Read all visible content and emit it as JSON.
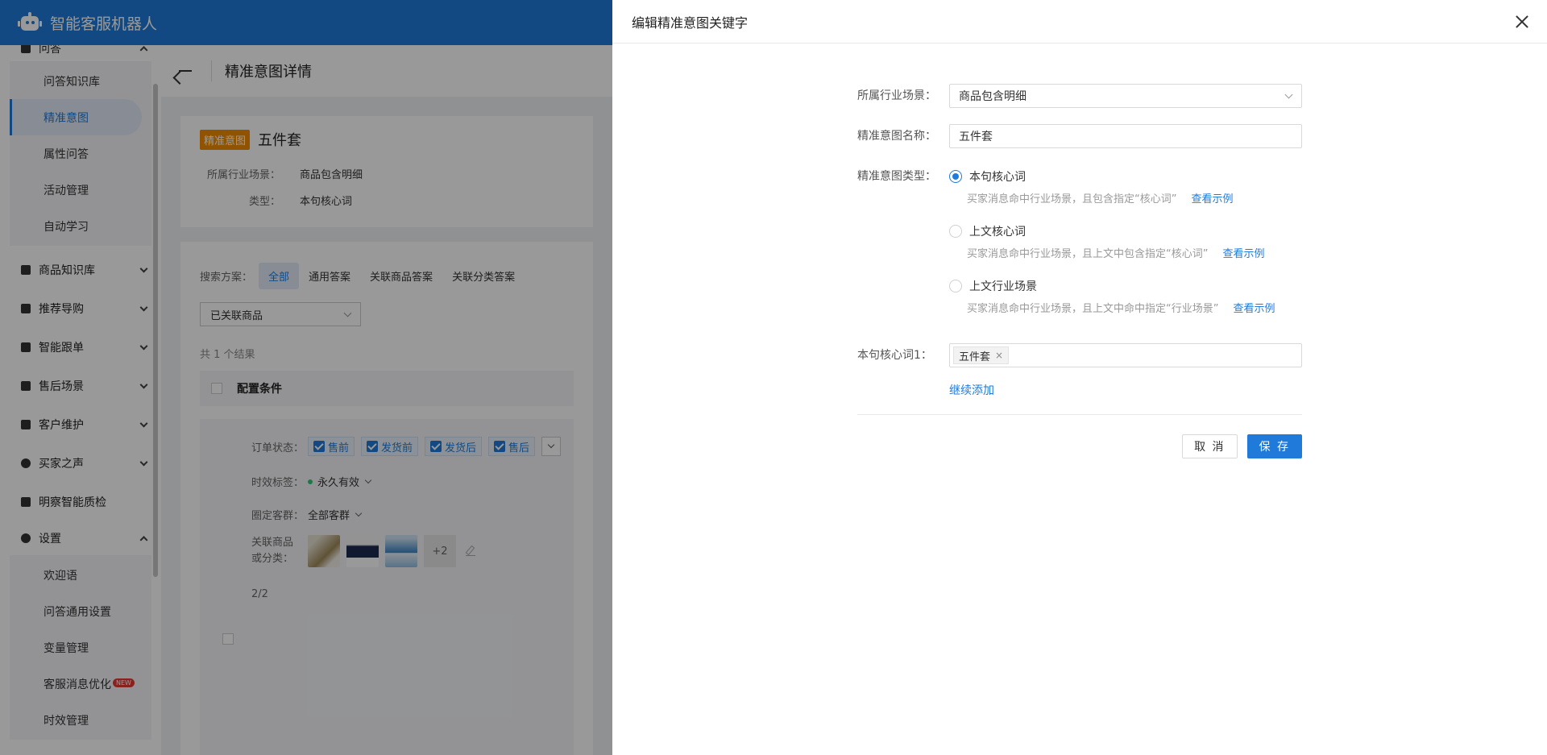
{
  "app": {
    "title": "智能客服机器人"
  },
  "sidebar": {
    "groups": [
      {
        "label": "问答",
        "items": [
          "问答知识库",
          "精准意图",
          "属性问答",
          "活动管理",
          "自动学习"
        ]
      },
      {
        "label": "商品知识库"
      },
      {
        "label": "推荐导购"
      },
      {
        "label": "智能跟单"
      },
      {
        "label": "售后场景"
      },
      {
        "label": "客户维护"
      },
      {
        "label": "买家之声"
      },
      {
        "label": "明察智能质检"
      },
      {
        "label": "设置",
        "items": [
          "欢迎语",
          "问答通用设置",
          "变量管理",
          "客服消息优化",
          "时效管理"
        ]
      }
    ],
    "new_badge": "NEW"
  },
  "main": {
    "page_title": "精准意图详情",
    "intent_tag": "精准意图",
    "intent_name": "五件套",
    "scene_label": "所属行业场景：",
    "scene_value": "商品包含明细",
    "type_label": "类型：",
    "type_value": "本句核心词",
    "search_label": "搜索方案：",
    "search_tabs": [
      "全部",
      "通用答案",
      "关联商品答案",
      "关联分类答案"
    ],
    "filter_value": "已关联商品",
    "result_count": "共 1 个结果",
    "table_header": "配置条件",
    "order_status_label": "订单状态：",
    "order_status_chips": [
      "售前",
      "发货前",
      "发货后",
      "售后"
    ],
    "time_tag_label": "时效标签：",
    "time_tag_value": "永久有效",
    "group_label": "圈定客群：",
    "group_value": "全部客群",
    "goods_label_1": "关联商品",
    "goods_label_2": "或分类：",
    "goods_more": "+2",
    "pager": "2/2"
  },
  "drawer": {
    "title": "编辑精准意图关键字",
    "scene_label": "所属行业场景：",
    "scene_value": "商品包含明细",
    "name_label": "精准意图名称：",
    "name_value": "五件套",
    "type_label": "精准意图类型：",
    "type_options": [
      {
        "label": "本句核心词",
        "desc": "买家消息命中行业场景，且包含指定“核心词”",
        "link": "查看示例",
        "selected": true
      },
      {
        "label": "上文核心词",
        "desc": "买家消息命中行业场景，且上文中包含指定“核心词”",
        "link": "查看示例",
        "selected": false
      },
      {
        "label": "上文行业场景",
        "desc": "买家消息命中行业场景，且上文中命中指定“行业场景”",
        "link": "查看示例",
        "selected": false
      }
    ],
    "keyword_label": "本句核心词1：",
    "keyword_tag": "五件套",
    "keyword_tag_close": "×",
    "add_more": "继续添加",
    "cancel": "取 消",
    "save": "保 存"
  },
  "colors": {
    "primary": "#1f7ad9",
    "tag_orange": "#f08c00",
    "header_blue": "#1f7ad9"
  }
}
